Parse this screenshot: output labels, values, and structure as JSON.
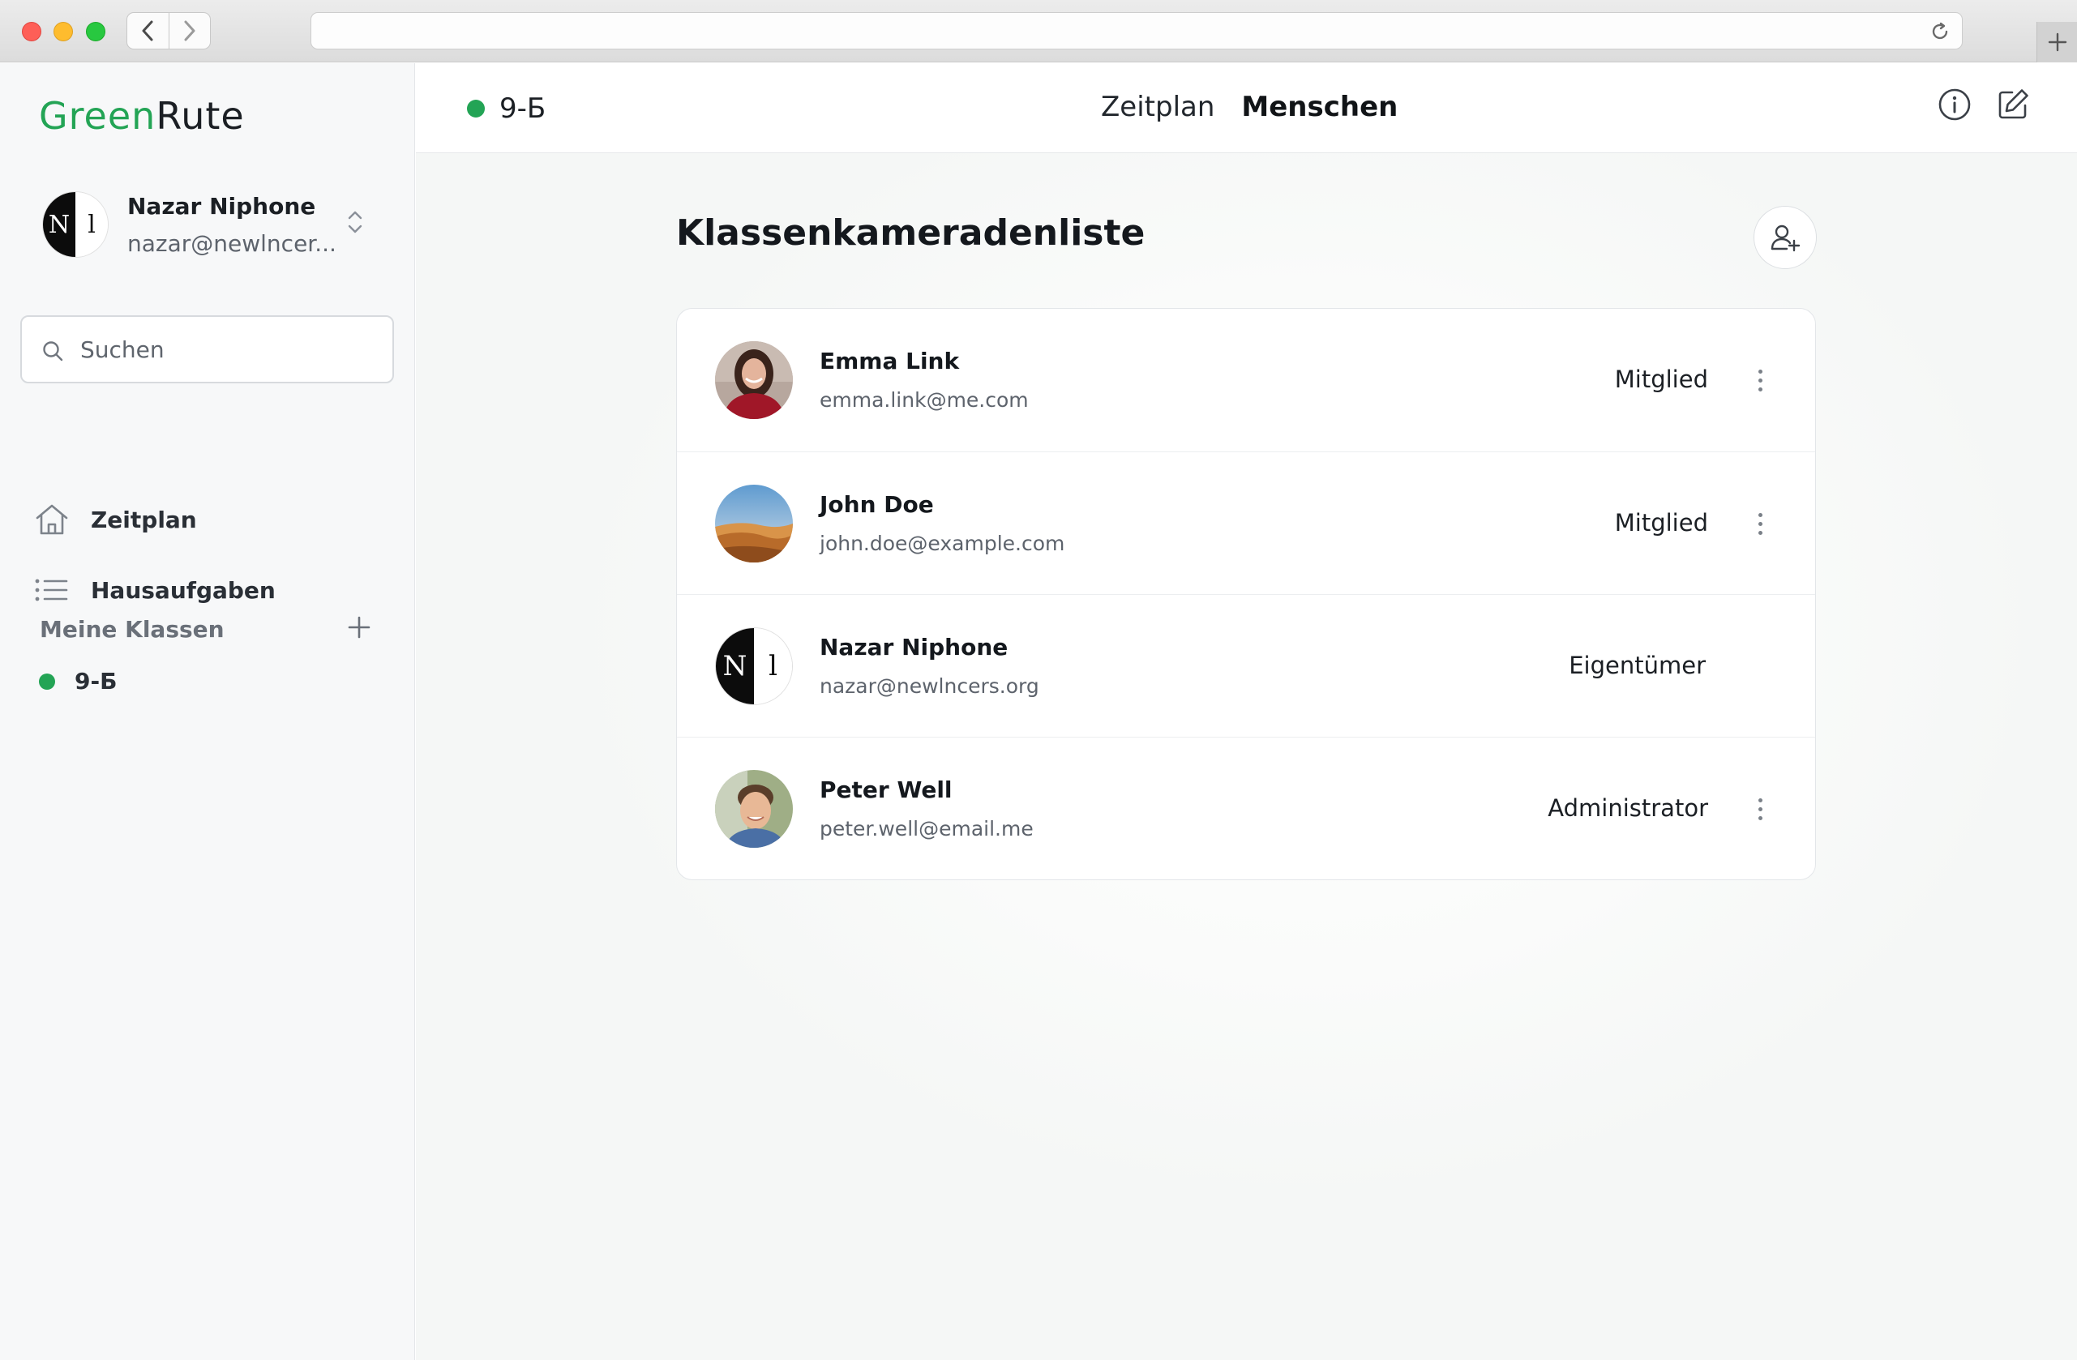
{
  "browser": {
    "url": ""
  },
  "app": {
    "logo_green": "Green",
    "logo_dark": "Rute"
  },
  "user": {
    "name": "Nazar Niphone",
    "email": "nazar@newlncer...",
    "avatar_letters": [
      "N",
      "l"
    ]
  },
  "search": {
    "placeholder": "Suchen",
    "value": ""
  },
  "sidebar": {
    "items": [
      {
        "label": "Zeitplan",
        "icon": "home-icon"
      },
      {
        "label": "Hausaufgaben",
        "icon": "list-icon"
      }
    ],
    "section_label": "Meine Klassen",
    "classes": [
      {
        "label": "9-Б",
        "color": "#23a455"
      }
    ]
  },
  "header": {
    "class_name": "9-Б",
    "class_color": "#23a455",
    "tabs": [
      {
        "label": "Zeitplan",
        "active": false
      },
      {
        "label": "Menschen",
        "active": true
      }
    ],
    "actions": [
      "info-icon",
      "edit-icon"
    ]
  },
  "main": {
    "title": "Klassenkameradenliste",
    "members": [
      {
        "name": "Emma Link",
        "email": "emma.link@me.com",
        "role": "Mitglied",
        "has_menu": true
      },
      {
        "name": "John Doe",
        "email": "john.doe@example.com",
        "role": "Mitglied",
        "has_menu": true
      },
      {
        "name": "Nazar Niphone",
        "email": "nazar@newlncers.org",
        "role": "Eigentümer",
        "has_menu": false
      },
      {
        "name": "Peter Well",
        "email": "peter.well@email.me",
        "role": "Administrator",
        "has_menu": true
      }
    ]
  },
  "colors": {
    "accent": "#23a455",
    "text": "#1b1f24",
    "muted": "#5d636c"
  }
}
